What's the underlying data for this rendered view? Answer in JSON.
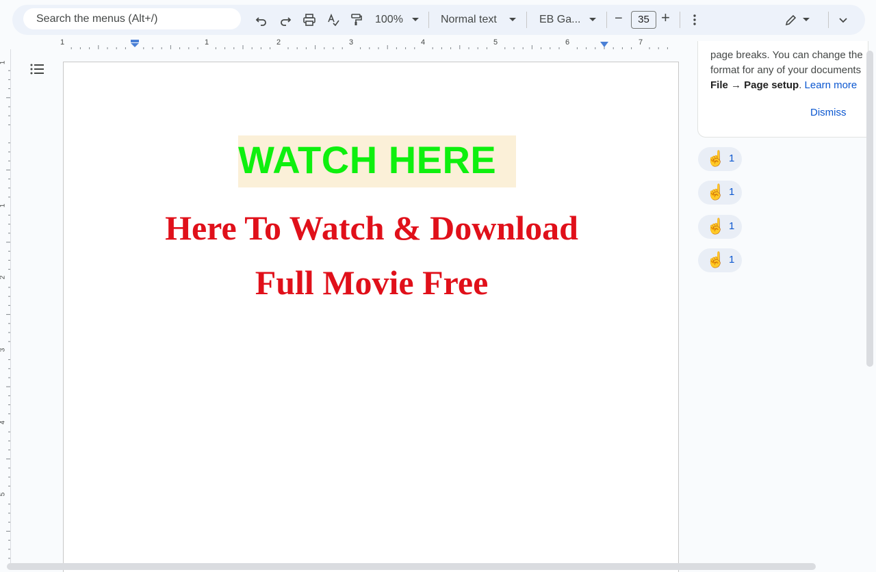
{
  "toolbar": {
    "search_placeholder": "Search the menus (Alt+/)",
    "zoom": "100%",
    "style": "Normal text",
    "font": "EB Ga...",
    "font_size": "35",
    "decrease_label": "−",
    "increase_label": "+"
  },
  "ruler": {
    "h_numbers": [
      "1",
      "1",
      "2",
      "3",
      "4",
      "5",
      "6",
      "7"
    ],
    "v_numbers": [
      "1",
      "1",
      "2",
      "3",
      "4",
      "5"
    ]
  },
  "document": {
    "watch_label": "WATCH HERE",
    "title_line1": "Here To Watch & Download",
    "title_line2": "Full Movie Free"
  },
  "notice": {
    "line1": "page breaks. You can change the",
    "line2": "format for any of your documents",
    "line3_bold": "File → Page setup",
    "line3_rest": ". ",
    "learn_more": "Learn more",
    "dismiss": "Dismiss"
  },
  "reactions": [
    {
      "emoji": "☝️",
      "count": "1"
    },
    {
      "emoji": "☝️",
      "count": "1"
    },
    {
      "emoji": "☝️",
      "count": "1"
    },
    {
      "emoji": "☝️",
      "count": "1"
    }
  ],
  "colors": {
    "watch_text": "#0ef00e",
    "watch_highlight": "#fbf0d8",
    "title_red": "#e0101a",
    "link_blue": "#0b57d0"
  }
}
